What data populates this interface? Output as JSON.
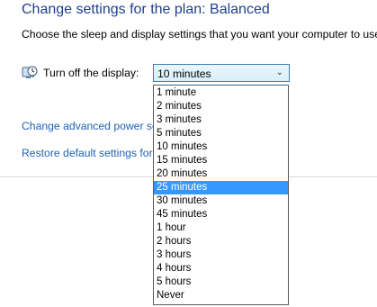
{
  "page": {
    "title": "Change settings for the plan: Balanced",
    "subtitle": "Choose the sleep and display settings that you want your computer to use."
  },
  "display_setting": {
    "label": "Turn off the display:",
    "selected_value": "10 minutes",
    "icon": "monitor-clock-icon"
  },
  "links": {
    "advanced": "Change advanced power se",
    "restore": "Restore default settings for"
  },
  "dropdown": {
    "highlighted": "25 minutes",
    "options": [
      "1 minute",
      "2 minutes",
      "3 minutes",
      "5 minutes",
      "10 minutes",
      "15 minutes",
      "20 minutes",
      "25 minutes",
      "30 minutes",
      "45 minutes",
      "1 hour",
      "2 hours",
      "3 hours",
      "4 hours",
      "5 hours",
      "Never"
    ]
  },
  "colors": {
    "title": "#1f3f8f",
    "link": "#1e63b5",
    "highlight": "#3399ff"
  }
}
